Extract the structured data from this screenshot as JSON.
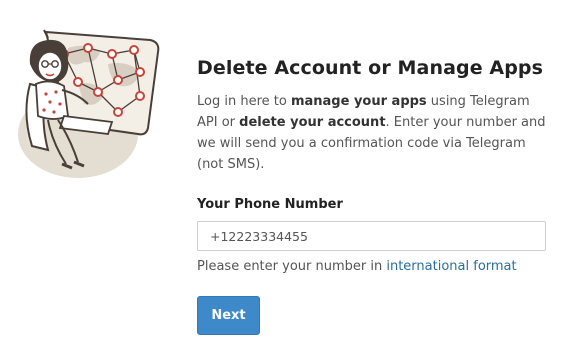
{
  "illustration": {
    "icon": "woman-with-map-illustration"
  },
  "heading": "Delete Account or Manage Apps",
  "description": {
    "p1": "Log in here to ",
    "b1": "manage your apps",
    "p2": " using Telegram API or ",
    "b2": "delete your account",
    "p3": ". Enter your number and we will send you a confirmation code via Telegram (not SMS)."
  },
  "phone": {
    "label": "Your Phone Number",
    "value": "+12223334455"
  },
  "hint": {
    "text": "Please enter your number in ",
    "link": "international format"
  },
  "next_label": "Next",
  "colors": {
    "accent": "#3d89c9",
    "link": "#2a6f9e"
  }
}
